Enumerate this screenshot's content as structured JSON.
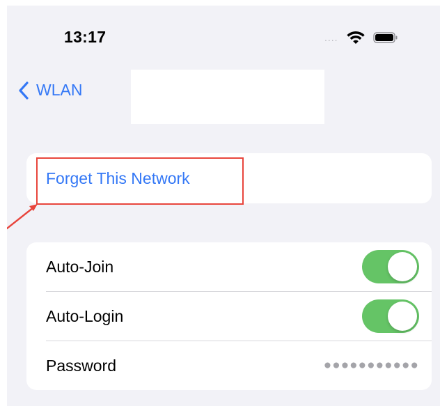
{
  "status_bar": {
    "time": "13:17",
    "signal_dots": "....",
    "wifi_icon": "wifi-icon",
    "battery_icon": "battery-icon"
  },
  "nav": {
    "back_label": "WLAN",
    "back_icon": "chevron-left-icon"
  },
  "forget_group": {
    "label": "Forget This Network"
  },
  "settings": {
    "rows": [
      {
        "label": "Auto-Join",
        "control": "toggle",
        "on": true
      },
      {
        "label": "Auto-Login",
        "control": "toggle",
        "on": true
      },
      {
        "label": "Password",
        "control": "text",
        "value": "●●●●●●●●●●●"
      }
    ]
  },
  "colors": {
    "accent": "#3478f6",
    "toggle_on": "#65c466",
    "background": "#f2f2f7",
    "highlight": "#e8453c"
  }
}
